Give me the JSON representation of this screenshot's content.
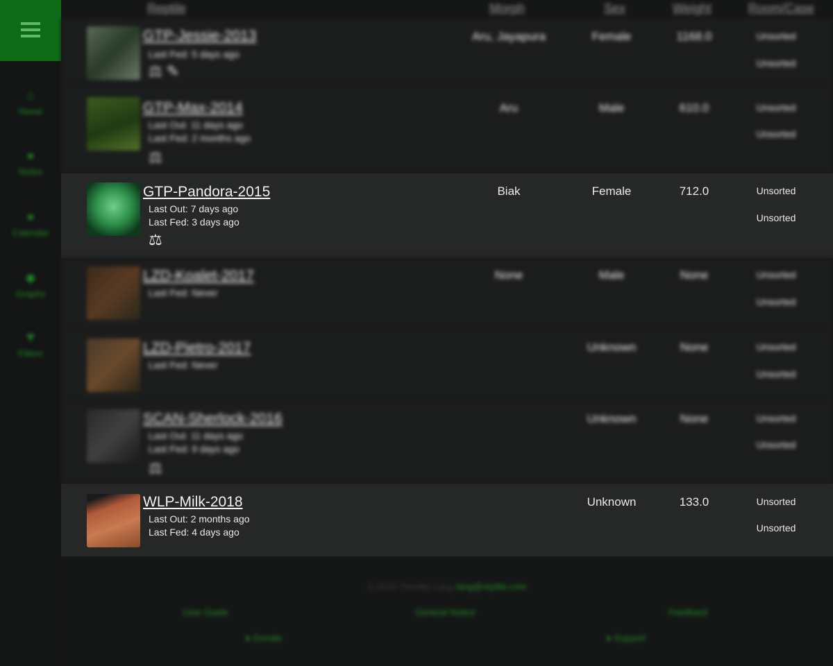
{
  "sidebar": {
    "items": [
      {
        "label": "Home",
        "icon": "home-icon"
      },
      {
        "label": "Notes",
        "icon": "notes-icon"
      },
      {
        "label": "Calendar",
        "icon": "calendar-icon"
      },
      {
        "label": "Graphs",
        "icon": "graphs-icon"
      },
      {
        "label": "Filters",
        "icon": "filter-icon"
      }
    ]
  },
  "table": {
    "headers": {
      "reptile": "Reptile",
      "morph": "Morph",
      "sex": "Sex",
      "weight": "Weight",
      "room": "Room/Case"
    }
  },
  "rows": [
    {
      "name": "GTP-Jessie-2013",
      "meta": [
        "Last Fed: 5 days ago"
      ],
      "morph": "Aru, Jayapura",
      "sex": "Female",
      "weight": "1168.0",
      "room1": "Unsorted",
      "room2": "Unsorted",
      "badges": "⚖ ✎",
      "focus": false
    },
    {
      "name": "GTP-Max-2014",
      "meta": [
        "Last Out: 11 days ago",
        "Last Fed: 2 months ago"
      ],
      "morph": "Aru",
      "sex": "Male",
      "weight": "610.0",
      "room1": "Unsorted",
      "room2": "Unsorted",
      "badges": "⚖",
      "focus": false
    },
    {
      "name": "GTP-Pandora-2015",
      "meta": [
        "Last Out: 7 days ago",
        "Last Fed: 3 days ago"
      ],
      "morph": "Biak",
      "sex": "Female",
      "weight": "712.0",
      "room1": "Unsorted",
      "room2": "Unsorted",
      "badges": "⚖",
      "focus": true
    },
    {
      "name": "LZD-Koalet-2017",
      "meta": [
        "Last Fed: Never"
      ],
      "morph": "None",
      "sex": "Male",
      "weight": "None",
      "room1": "Unsorted",
      "room2": "Unsorted",
      "badges": "",
      "focus": false
    },
    {
      "name": "LZD-Pietro-2017",
      "meta": [
        "Last Fed: Never"
      ],
      "morph": "",
      "sex": "Unknown",
      "weight": "None",
      "room1": "Unsorted",
      "room2": "Unsorted",
      "badges": "",
      "focus": false
    },
    {
      "name": "SCAN-Sherlock-2016",
      "meta": [
        "Last Out: 11 days ago",
        "Last Fed: 9 days ago"
      ],
      "morph": "",
      "sex": "Unknown",
      "weight": "None",
      "room1": "Unsorted",
      "room2": "Unsorted",
      "badges": "⚖",
      "focus": false
    },
    {
      "name": "WLP-Milk-2018",
      "meta": [
        "Last Out: 2 months ago",
        "Last Fed: 4 days ago"
      ],
      "morph": "",
      "sex": "Unknown",
      "weight": "133.0",
      "room1": "Unsorted",
      "room2": "Unsorted",
      "badges": "",
      "focus": true
    }
  ],
  "footer": {
    "copyright": "© 2019 Timothy Lang",
    "email": "lang@reptile.com",
    "links": [
      "User Guide",
      "General Notice",
      "Feedback"
    ],
    "social": [
      "Donate",
      "Support"
    ]
  },
  "colors": {
    "accent": "#1f8e25",
    "sidebar_header": "#0e6b18",
    "row_focus": "#262727"
  }
}
